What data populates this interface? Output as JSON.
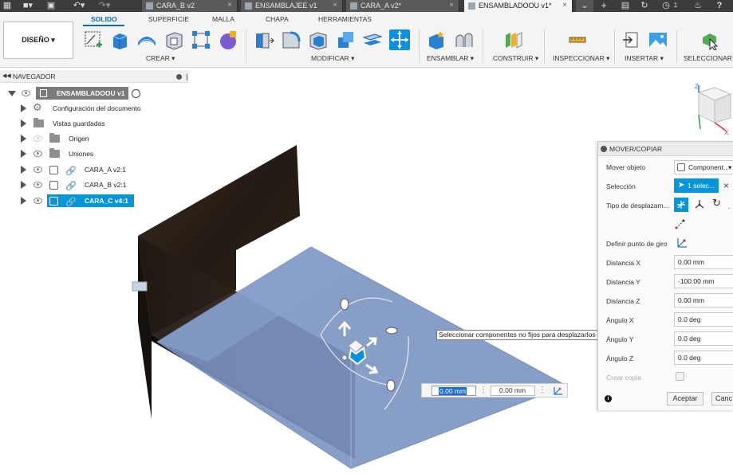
{
  "title_bar": {
    "tabs": [
      {
        "label": "CARA_B v2",
        "active": false
      },
      {
        "label": "ENSAMBLAJEE v1",
        "active": false
      },
      {
        "label": "CARA_A v2*",
        "active": false
      },
      {
        "label": "ENSAMBLADOOU v1*",
        "active": true
      }
    ],
    "notification_count": "1"
  },
  "ribbon": {
    "tabs": [
      "SOLIDO",
      "SUPERFICIE",
      "MALLA",
      "CHAPA",
      "HERRAMIENTAS"
    ],
    "active_tab": "SOLIDO",
    "workspace_button": "DISEÑO",
    "groups": [
      "CREAR",
      "MODIFICAR",
      "ENSAMBLAR",
      "CONSTRUIR",
      "INSPECCIONAR",
      "INSERTAR",
      "SELECCIONAR"
    ]
  },
  "navigator": {
    "header": "NAVEGADOR",
    "root": "ENSAMBLADOOU v1",
    "items": [
      {
        "label": "Configuración del documento",
        "icon": "gear-icon"
      },
      {
        "label": "Vistas guardadas",
        "icon": "folder-icon"
      },
      {
        "label": "Origen",
        "icon": "folder-icon"
      },
      {
        "label": "Uniones",
        "icon": "folder-icon"
      },
      {
        "label": "CARA_A v2:1",
        "icon": "component-link-icon"
      },
      {
        "label": "CARA_B v2:1",
        "icon": "component-link-icon"
      },
      {
        "label": "CARA_C v4:1",
        "icon": "component-link-icon",
        "selected": true
      }
    ]
  },
  "viewcube": {
    "axis_z": "Z",
    "axis_x": "X"
  },
  "tooltip": "Seleccionar componentes no fijos para desplazarlos",
  "inline_inputs": {
    "first": "0.00 mm",
    "second": "0.00 mm"
  },
  "panel": {
    "title": "MOVER/COPIAR",
    "move_object_label": "Mover objeto",
    "move_object_value": "Component...",
    "selection_label": "Selección",
    "selection_value": "1 selec...",
    "move_type_label": "Tipo de desplazam...",
    "pivot_label": "Definir punto de giro",
    "distance_x_label": "Distancia X",
    "distance_x": "0.00 mm",
    "distance_y_label": "Distancia Y",
    "distance_y": "-100.00 mm",
    "distance_z_label": "Distancia Z",
    "distance_z": "0.00 mm",
    "angle_x_label": "Ángulo X",
    "angle_x": "0.0 deg",
    "angle_y_label": "Ángulo Y",
    "angle_y": "0.0 deg",
    "angle_z_label": "Ángulo Z",
    "angle_z": "0.0 deg",
    "create_copy_label": "Crear copia",
    "ok_label": "Aceptar",
    "cancel_label": "Canc"
  },
  "colors": {
    "accent": "#0b6fb8",
    "selection": "#0696d7",
    "plate": "#7f97c4",
    "wood": "#2b2119"
  }
}
